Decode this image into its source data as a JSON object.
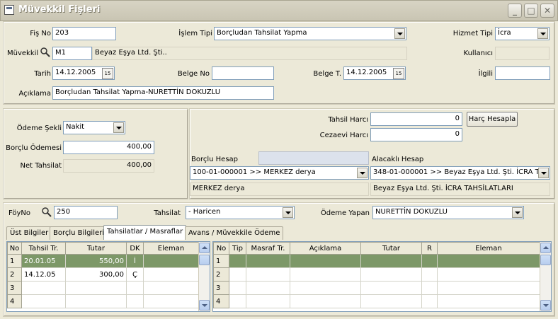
{
  "window": {
    "title": "Müvekkil Fişleri",
    "min": "_",
    "max": "□",
    "close": "✕"
  },
  "header": {
    "fis_no_label": "Fiş No",
    "fis_no": "203",
    "islem_tipi_label": "İşlem Tipi",
    "islem_tipi": "Borçludan Tahsilat Yapma",
    "hizmet_tipi_label": "Hizmet Tipi",
    "hizmet_tipi": "İcra",
    "muvekkil_label": "Müvekkil",
    "muvekkil_code": "M1",
    "muvekkil_name": "Beyaz Eşya Ltd. Şti..",
    "kullanici_label": "Kullanıcı",
    "tarih_label": "Tarih",
    "tarih": "14.12.2005",
    "belge_no_label": "Belge No",
    "belge_t_label": "Belge T.",
    "belge_t": "14.12.2005",
    "ilgili_label": "İlgili",
    "aciklama_label": "Açıklama",
    "aciklama": "Borçludan Tahsilat Yapma-NURETTİN DOKUZLU",
    "cal_icon_text": "15"
  },
  "payment": {
    "odeme_sekli_label": "Ödeme Şekli",
    "odeme_sekli": "Nakit",
    "borclu_odemesi_label": "Borçlu Ödemesi",
    "borclu_odemesi": "400,00",
    "net_tahsilat_label": "Net Tahsilat",
    "net_tahsilat": "400,00"
  },
  "fees": {
    "tahsil_harci_label": "Tahsil Harcı",
    "tahsil_harci": "0",
    "cezaevi_harci_label": "Cezaevi Harcı",
    "cezaevi_harci": "0",
    "harc_button": "Harç Hesapla",
    "borclu_hesap_label": "Borçlu Hesap",
    "borclu_hesap": "100-01-000001 >> MERKEZ derya",
    "borclu_hesap_name": "MERKEZ derya",
    "alacakli_hesap_label": "Alacaklı Hesap",
    "alacakli_hesap": "348-01-000001 >> Beyaz Eşya Ltd. Şti. İCRA TAI",
    "alacakli_hesap_name": "Beyaz Eşya Ltd. Şti. İCRA TAHSİLATLARI"
  },
  "file": {
    "foy_no_label": "FöyNo",
    "foy_no": "250",
    "tahsilat_label": "Tahsilat",
    "tahsilat": "- Haricen",
    "odeme_yapan_label": "Ödeme Yapan",
    "odeme_yapan": "NURETTİN DOKUZLU"
  },
  "tabs": [
    "Üst Bilgiler",
    "Borçlu Bilgileri",
    "Tahsilatlar / Masraflar",
    "Avans / Müvekkile Ödeme"
  ],
  "left_grid": {
    "columns": [
      "No",
      "Tahsil Tr.",
      "Tutar",
      "DK",
      "Eleman"
    ],
    "rows": [
      {
        "no": "1",
        "tarih": "20.01.05",
        "tutar": "550,00",
        "dk": "İ",
        "eleman": ""
      },
      {
        "no": "2",
        "tarih": "14.12.05",
        "tutar": "300,00",
        "dk": "Ç",
        "eleman": ""
      },
      {
        "no": "3",
        "tarih": "",
        "tutar": "",
        "dk": "",
        "eleman": ""
      },
      {
        "no": "4",
        "tarih": "",
        "tutar": "",
        "dk": "",
        "eleman": ""
      }
    ]
  },
  "right_grid": {
    "columns": [
      "No",
      "Tip",
      "Masraf Tr.",
      "Açıklama",
      "Tutar",
      "R",
      "Eleman"
    ],
    "rows": [
      {
        "no": "1"
      },
      {
        "no": "2"
      },
      {
        "no": "3"
      },
      {
        "no": "4"
      }
    ]
  }
}
